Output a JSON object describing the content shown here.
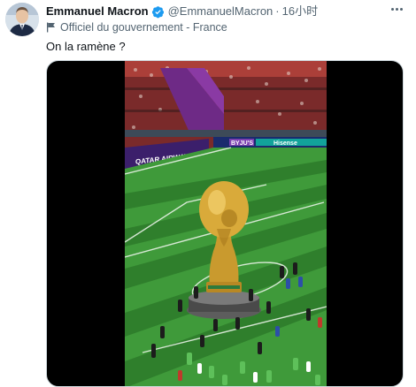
{
  "author": {
    "name": "Emmanuel Macron",
    "handle": "@EmmanuelMacron",
    "separator": "·",
    "timestamp": "16小时",
    "verified": true,
    "affiliation": "Officiel du gouvernement - France"
  },
  "tweet": {
    "text": "On la ramène ?"
  },
  "media": {
    "type": "video",
    "stadium_boards": {
      "left_board": "QATAR AIRWAYS",
      "right_board_1": "BYJU'S",
      "right_board_2": "Hisense"
    }
  },
  "icons": {
    "verified": "verified-badge-icon",
    "affiliation": "flag-icon",
    "menu": "more-options-icon"
  },
  "colors": {
    "verified_blue": "#1d9bf0",
    "secondary_text": "#536471",
    "primary_text": "#0f1419",
    "pitch_green": "#3f9a3a",
    "pitch_green_dark": "#2f7f2c"
  }
}
